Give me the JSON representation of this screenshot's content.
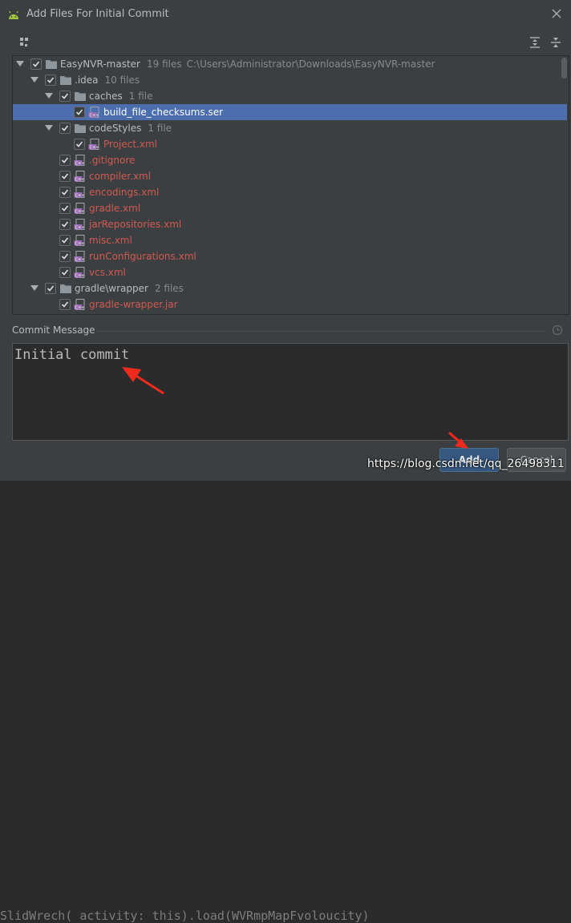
{
  "dialog": {
    "title": "Add Files For Initial Commit",
    "accent_color": "#4b6eaf",
    "modified_color": "#d05a52"
  },
  "toolbar": {
    "group_icon": "group-by-icon",
    "expand_icon": "expand-all-icon",
    "collapse_icon": "collapse-all-icon"
  },
  "tree": {
    "rows": [
      {
        "name": "EasyNVR-master",
        "sub": "19 files",
        "path": "C:\\Users\\Administrator\\Downloads\\EasyNVR-master"
      },
      {
        "name": ".idea",
        "sub": "10 files"
      },
      {
        "name": "caches",
        "sub": "1 file"
      },
      {
        "name": "build_file_checksums.ser"
      },
      {
        "name": "codeStyles",
        "sub": "1 file"
      },
      {
        "name": "Project.xml"
      },
      {
        "name": ".gitignore"
      },
      {
        "name": "compiler.xml"
      },
      {
        "name": "encodings.xml"
      },
      {
        "name": "gradle.xml"
      },
      {
        "name": "jarRepositories.xml"
      },
      {
        "name": "misc.xml"
      },
      {
        "name": "runConfigurations.xml"
      },
      {
        "name": "vcs.xml"
      },
      {
        "name": "gradle\\wrapper",
        "sub": "2 files"
      },
      {
        "name": "gradle-wrapper.jar"
      }
    ]
  },
  "commit": {
    "label": "Commit Message",
    "message": "Initial commit"
  },
  "buttons": {
    "add": "Add",
    "cancel": "Cancel"
  },
  "background_code": "SlidWrech( activity: this).load(WVRmpMapFvoloucity)",
  "watermark": "https://blog.csdn.net/qq_26498311"
}
